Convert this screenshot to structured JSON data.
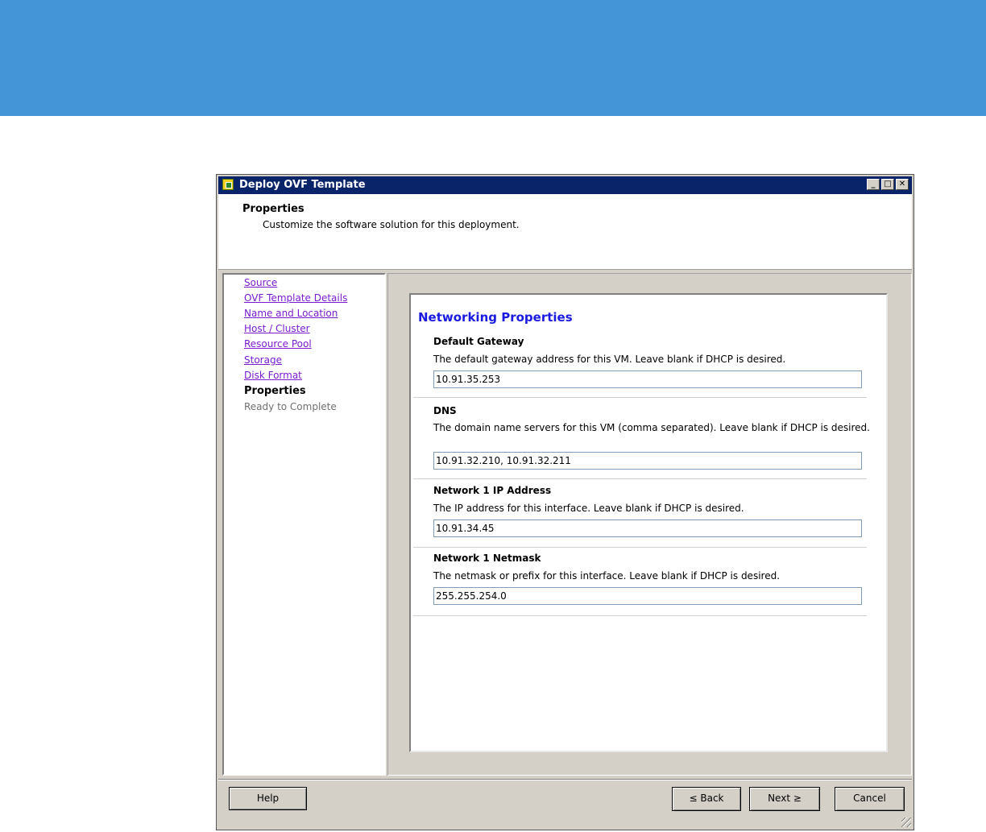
{
  "window": {
    "title": "Deploy OVF Template",
    "controls": {
      "minimize": "_",
      "maximize": "□",
      "close": "✕"
    }
  },
  "header": {
    "title": "Properties",
    "subtitle": "Customize the software solution for this deployment."
  },
  "nav": {
    "items": [
      {
        "label": "Source",
        "state": "link"
      },
      {
        "label": "OVF Template Details",
        "state": "link"
      },
      {
        "label": "Name and Location",
        "state": "link"
      },
      {
        "label": "Host / Cluster",
        "state": "link"
      },
      {
        "label": "Resource Pool",
        "state": "link"
      },
      {
        "label": "Storage",
        "state": "link"
      },
      {
        "label": "Disk Format",
        "state": "link"
      },
      {
        "label": "Properties",
        "state": "current"
      },
      {
        "label": "Ready to Complete",
        "state": "disabled"
      }
    ]
  },
  "properties": {
    "section_title": "Networking Properties",
    "fields": [
      {
        "label": "Default Gateway",
        "description": "The default gateway address for this VM. Leave blank if DHCP is desired.",
        "value": "10.91.35.253"
      },
      {
        "label": "DNS",
        "description": "The domain name servers for this VM (comma separated). Leave blank if DHCP is desired.",
        "value": "10.91.32.210, 10.91.32.211"
      },
      {
        "label": "Network 1 IP Address",
        "description": "The IP address for this interface. Leave blank if DHCP is desired.",
        "value": "10.91.34.45"
      },
      {
        "label": "Network 1 Netmask",
        "description": "The netmask or prefix for this interface. Leave blank if DHCP is desired.",
        "value": "255.255.254.0"
      }
    ]
  },
  "buttons": {
    "help": "Help",
    "back": "≤ Back",
    "next": "Next ≥",
    "cancel": "Cancel"
  },
  "colors": {
    "banner": "#4395d8",
    "titlebar": "#0a246a",
    "link": "#7a1bd0",
    "section_title": "#1a1ae0"
  }
}
